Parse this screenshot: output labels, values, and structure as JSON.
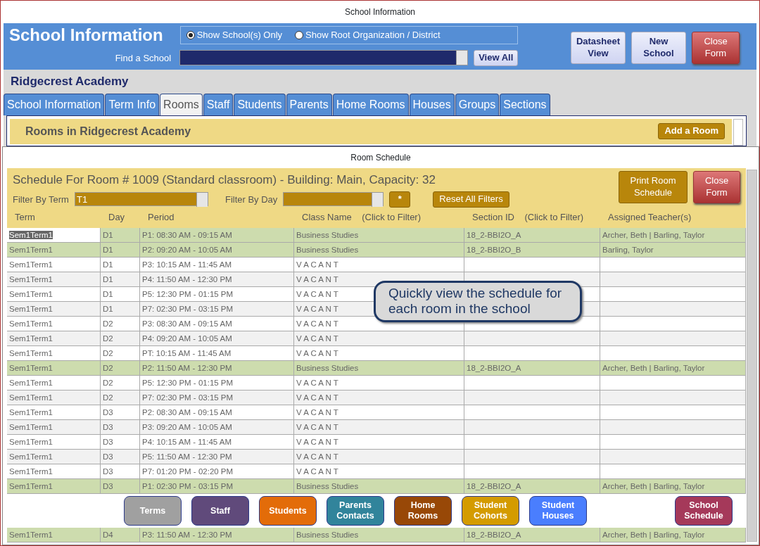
{
  "window": {
    "title": "School Information"
  },
  "header": {
    "title": "School Information",
    "radios": [
      {
        "label": "Show School(s) Only",
        "selected": true
      },
      {
        "label": "Show Root Organization / District",
        "selected": false
      }
    ],
    "find_label": "Find a School",
    "view_all": "View All",
    "buttons": [
      {
        "label": "Datasheet View",
        "kind": "light"
      },
      {
        "label": "New School",
        "kind": "light"
      },
      {
        "label": "Close Form",
        "kind": "close"
      }
    ]
  },
  "school_name": "Ridgecrest Academy",
  "tabs": [
    {
      "label": "School Information",
      "selected": false
    },
    {
      "label": "Term Info",
      "selected": false
    },
    {
      "label": "Rooms",
      "selected": true
    },
    {
      "label": "Staff",
      "selected": false
    },
    {
      "label": "Students",
      "selected": false
    },
    {
      "label": "Parents",
      "selected": false
    },
    {
      "label": "Home Rooms",
      "selected": false
    },
    {
      "label": "Houses",
      "selected": false
    },
    {
      "label": "Groups",
      "selected": false
    },
    {
      "label": "Sections",
      "selected": false
    }
  ],
  "rooms_panel": {
    "title": "Rooms in Ridgecrest Academy",
    "add_button": "Add a Room"
  },
  "schedule_window": {
    "title": "Room Schedule",
    "heading": "Schedule For Room # 1009 (Standard classroom) - Building: Main, Capacity: 32",
    "filter_term_label": "Filter By Term",
    "filter_term_value": "T1",
    "filter_day_label": "Filter By Day",
    "star_button": "*",
    "reset_button": "Reset All Filters",
    "print_button": "Print Room Schedule",
    "close_button": "Close Form",
    "columns": [
      "Term",
      "Day",
      "Period",
      "Class Name    (Click to Filter)",
      "Section ID    (Click to Filter)",
      "Assigned Teacher(s)"
    ],
    "rows": [
      {
        "kind": "booked",
        "selected": true,
        "cells": [
          "Sem1Term1",
          "D1",
          "P1: 08:30 AM - 09:15 AM",
          "Business Studies",
          "18_2-BBI2O_A",
          "Archer, Beth | Barling, Taylor"
        ]
      },
      {
        "kind": "booked",
        "selected": false,
        "cells": [
          "Sem1Term1",
          "D1",
          "P2: 09:20 AM - 10:05 AM",
          "Business Studies",
          "18_2-BBI2O_B",
          "Barling, Taylor"
        ]
      },
      {
        "kind": "vacant",
        "selected": false,
        "cells": [
          "Sem1Term1",
          "D1",
          "P3: 10:15 AM - 11:45 AM",
          "V A C A N T",
          "",
          ""
        ]
      },
      {
        "kind": "vacant",
        "selected": false,
        "cells": [
          "Sem1Term1",
          "D1",
          "P4: 11:50 AM - 12:30 PM",
          "V A C A N T",
          "",
          ""
        ]
      },
      {
        "kind": "vacant",
        "selected": false,
        "cells": [
          "Sem1Term1",
          "D1",
          "P5: 12:30 PM - 01:15 PM",
          "V A C A N T",
          "",
          ""
        ]
      },
      {
        "kind": "vacant",
        "selected": false,
        "cells": [
          "Sem1Term1",
          "D1",
          "P7: 02:30 PM - 03:15 PM",
          "V A C A N T",
          "",
          ""
        ]
      },
      {
        "kind": "vacant",
        "selected": false,
        "cells": [
          "Sem1Term1",
          "D2",
          "P3: 08:30 AM - 09:15 AM",
          "V A C A N T",
          "",
          ""
        ]
      },
      {
        "kind": "vacant",
        "selected": false,
        "cells": [
          "Sem1Term1",
          "D2",
          "P4: 09:20 AM - 10:05 AM",
          "V A C A N T",
          "",
          ""
        ]
      },
      {
        "kind": "vacant",
        "selected": false,
        "cells": [
          "Sem1Term1",
          "D2",
          "PT: 10:15 AM - 11:45 AM",
          "V A C A N T",
          "",
          ""
        ]
      },
      {
        "kind": "booked",
        "selected": false,
        "cells": [
          "Sem1Term1",
          "D2",
          "P2: 11:50 AM - 12:30 PM",
          "Business Studies",
          "18_2-BBI2O_A",
          "Archer, Beth | Barling, Taylor"
        ]
      },
      {
        "kind": "vacant",
        "selected": false,
        "cells": [
          "Sem1Term1",
          "D2",
          "P5: 12:30 PM - 01:15 PM",
          "V A C A N T",
          "",
          ""
        ]
      },
      {
        "kind": "vacant",
        "selected": false,
        "cells": [
          "Sem1Term1",
          "D2",
          "P7: 02:30 PM - 03:15 PM",
          "V A C A N T",
          "",
          ""
        ]
      },
      {
        "kind": "vacant",
        "selected": false,
        "cells": [
          "Sem1Term1",
          "D3",
          "P2: 08:30 AM - 09:15 AM",
          "V A C A N T",
          "",
          ""
        ]
      },
      {
        "kind": "vacant",
        "selected": false,
        "cells": [
          "Sem1Term1",
          "D3",
          "P3: 09:20 AM - 10:05 AM",
          "V A C A N T",
          "",
          ""
        ]
      },
      {
        "kind": "vacant",
        "selected": false,
        "cells": [
          "Sem1Term1",
          "D3",
          "P4: 10:15 AM - 11:45 AM",
          "V A C A N T",
          "",
          ""
        ]
      },
      {
        "kind": "vacant",
        "selected": false,
        "cells": [
          "Sem1Term1",
          "D3",
          "P5: 11:50 AM - 12:30 PM",
          "V A C A N T",
          "",
          ""
        ]
      },
      {
        "kind": "vacant",
        "selected": false,
        "cells": [
          "Sem1Term1",
          "D3",
          "P7: 01:20 PM - 02:20 PM",
          "V A C A N T",
          "",
          ""
        ]
      },
      {
        "kind": "booked",
        "selected": false,
        "cells": [
          "Sem1Term1",
          "D3",
          "P1: 02:30 PM - 03:15 PM",
          "Business Studies",
          "18_2-BBI2O_A",
          "Archer, Beth | Barling, Taylor"
        ]
      }
    ],
    "nav_buttons": [
      {
        "label": "Terms",
        "color": "#a0a0a0"
      },
      {
        "label": "Staff",
        "color": "#604a7b"
      },
      {
        "label": "Students",
        "color": "#e36c09"
      },
      {
        "label": "Parents Contacts",
        "color": "#31849b"
      },
      {
        "label": "Home Rooms",
        "color": "#984807"
      },
      {
        "label": "Student Cohorts",
        "color": "#d49b00"
      },
      {
        "label": "Student Houses",
        "color": "#4a7efe"
      }
    ],
    "end_buttons": [
      {
        "label": "School Schedule",
        "color": "#a5395a"
      }
    ],
    "last_row": {
      "kind": "booked",
      "selected": false,
      "cells": [
        "Sem1Term1",
        "D4",
        "P3: 11:50 AM - 12:30 PM",
        "Business Studies",
        "18_2-BBI2O_A",
        "Archer, Beth | Barling, Taylor"
      ]
    },
    "callout": "Quickly view the schedule for each room in the school"
  }
}
